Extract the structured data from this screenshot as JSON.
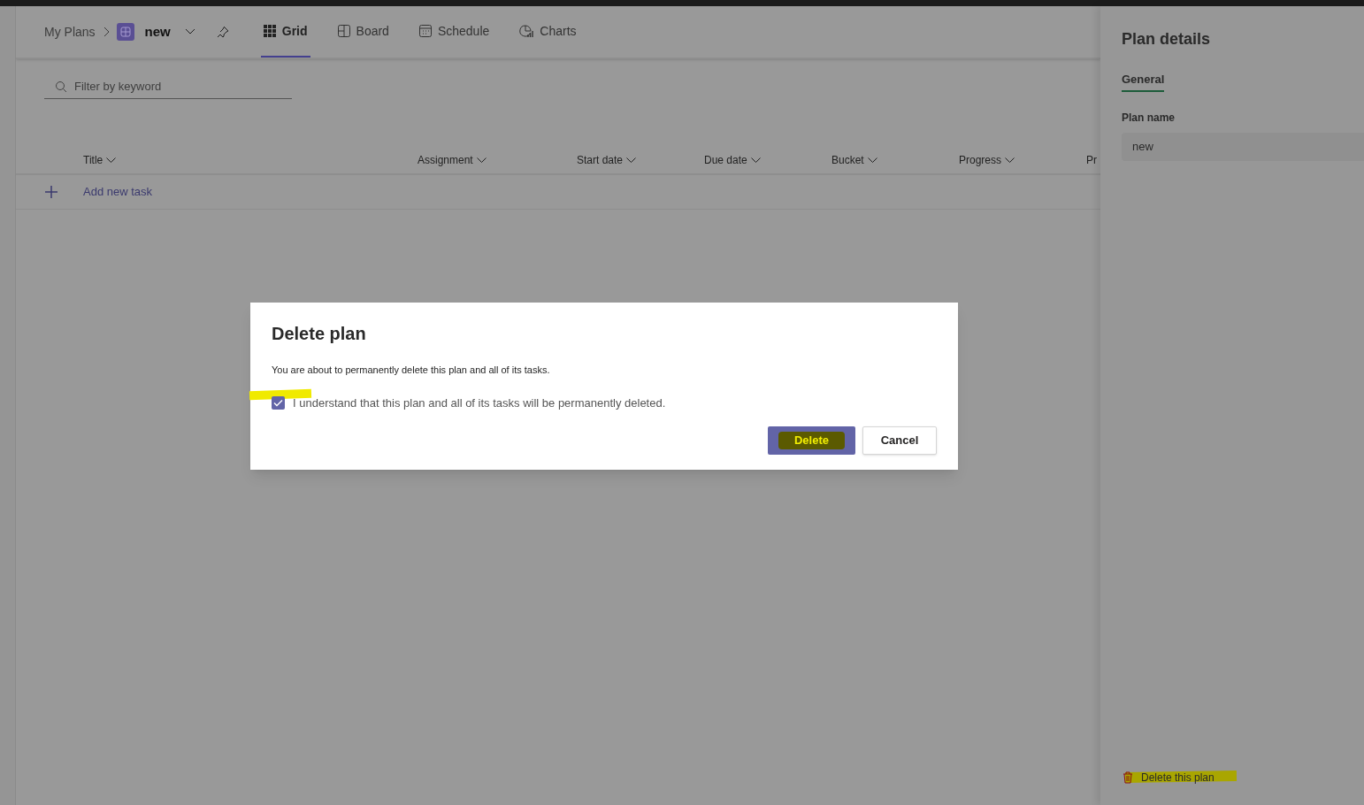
{
  "breadcrumb": {
    "root": "My Plans",
    "plan_name": "new"
  },
  "tabs": [
    {
      "label": "Grid",
      "kind": "grid",
      "selected": true
    },
    {
      "label": "Board",
      "kind": "board",
      "selected": false
    },
    {
      "label": "Schedule",
      "kind": "schedule",
      "selected": false
    },
    {
      "label": "Charts",
      "kind": "charts",
      "selected": false
    }
  ],
  "filter": {
    "placeholder": "Filter by keyword"
  },
  "table": {
    "columns": [
      "Title",
      "Assignment",
      "Start date",
      "Due date",
      "Bucket",
      "Progress",
      "Pr"
    ],
    "add_task": "Add new task"
  },
  "dialog": {
    "title": "Delete plan",
    "message": "You are about to permanently delete this plan and all of its tasks.",
    "checkbox": {
      "label": "I understand that this plan and all of its tasks will be permanently deleted.",
      "checked": true,
      "highlighted": true
    },
    "buttons": [
      {
        "label": "Delete",
        "kind": "primary",
        "highlighted": true
      },
      {
        "label": "Cancel",
        "kind": "secondary",
        "highlighted": false
      }
    ]
  },
  "panel": {
    "title": "Plan details",
    "tabs": [
      {
        "label": "General",
        "selected": true
      }
    ],
    "field": {
      "label": "Plan name",
      "value": "new"
    },
    "delete_link": {
      "label": "Delete this plan",
      "highlighted": true
    }
  }
}
